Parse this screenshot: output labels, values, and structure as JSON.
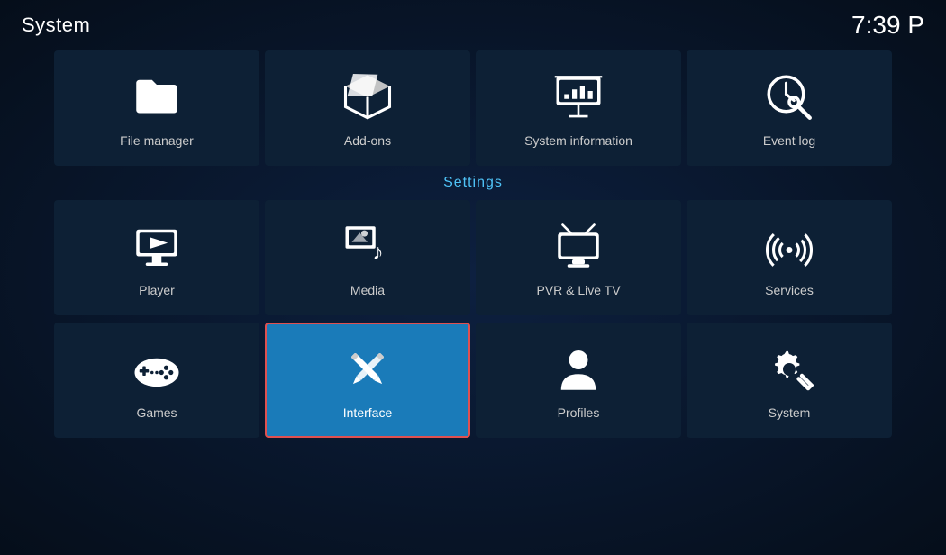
{
  "header": {
    "title": "System",
    "time": "7:39 P"
  },
  "sections": {
    "settings_label": "Settings"
  },
  "tiles": {
    "row1": [
      {
        "id": "file-manager",
        "label": "File manager",
        "icon": "folder"
      },
      {
        "id": "add-ons",
        "label": "Add-ons",
        "icon": "box"
      },
      {
        "id": "system-information",
        "label": "System information",
        "icon": "presentation"
      },
      {
        "id": "event-log",
        "label": "Event log",
        "icon": "clock-search"
      }
    ],
    "row2": [
      {
        "id": "player",
        "label": "Player",
        "icon": "play"
      },
      {
        "id": "media",
        "label": "Media",
        "icon": "media"
      },
      {
        "id": "pvr-live-tv",
        "label": "PVR & Live TV",
        "icon": "tv"
      },
      {
        "id": "services",
        "label": "Services",
        "icon": "broadcast"
      }
    ],
    "row3": [
      {
        "id": "games",
        "label": "Games",
        "icon": "gamepad"
      },
      {
        "id": "interface",
        "label": "Interface",
        "icon": "pencil-cross",
        "active": true
      },
      {
        "id": "profiles",
        "label": "Profiles",
        "icon": "person"
      },
      {
        "id": "system",
        "label": "System",
        "icon": "gear-fork"
      }
    ]
  }
}
